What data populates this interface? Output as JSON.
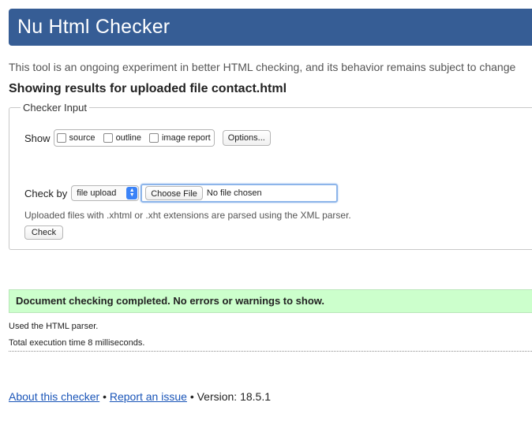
{
  "header": {
    "title": "Nu Html Checker"
  },
  "tagline": "This tool is an ongoing experiment in better HTML checking, and its behavior remains subject to change",
  "results_heading": "Showing results for uploaded file contact.html",
  "checker_input": {
    "legend": "Checker Input",
    "show_label": "Show",
    "options": [
      {
        "label": "source",
        "checked": false
      },
      {
        "label": "outline",
        "checked": false
      },
      {
        "label": "image report",
        "checked": false
      }
    ],
    "options_button": "Options...",
    "check_by_label": "Check by",
    "check_by_selected": "file upload",
    "choose_file_button": "Choose File",
    "no_file_text": "No file chosen",
    "xml_note": "Uploaded files with .xhtml or .xht extensions are parsed using the XML parser.",
    "check_button": "Check"
  },
  "result": {
    "success_message": "Document checking completed. No errors or warnings to show.",
    "parser_line": "Used the HTML parser.",
    "time_line": "Total execution time 8 milliseconds."
  },
  "footer": {
    "about_link": "About this checker",
    "separator": "•",
    "report_link": "Report an issue",
    "version_text": "Version: 18.5.1"
  },
  "colors": {
    "header_bg": "#365d95",
    "success_bg": "#ccffcc",
    "link": "#1a55b8"
  }
}
